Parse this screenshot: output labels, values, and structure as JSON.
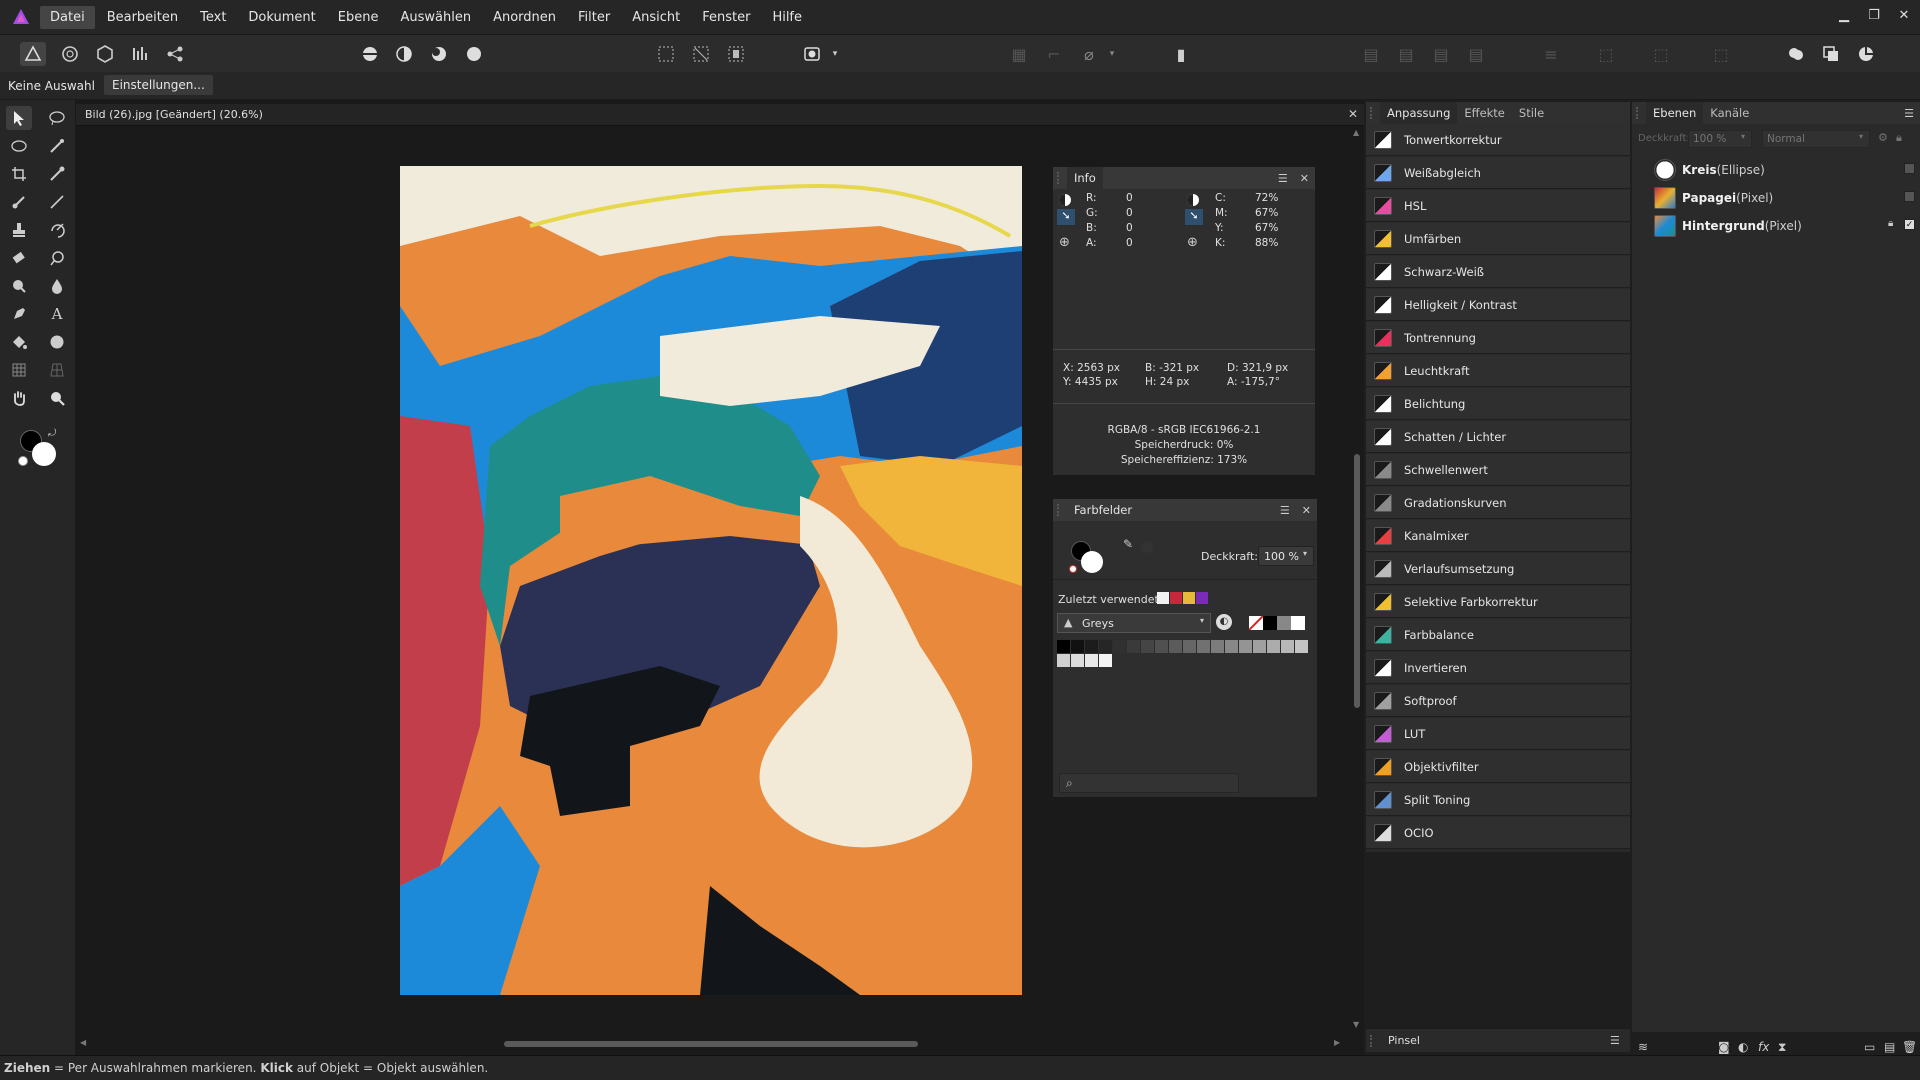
{
  "menu": {
    "items": [
      "Datei",
      "Bearbeiten",
      "Text",
      "Dokument",
      "Ebene",
      "Auswählen",
      "Anordnen",
      "Filter",
      "Ansicht",
      "Fenster",
      "Hilfe"
    ],
    "active_index": 0
  },
  "context": {
    "selection": "Keine Auswahl",
    "settings_button": "Einstellungen..."
  },
  "document": {
    "tab_title": "Bild (26).jpg [Geändert] (20.6%)",
    "close_symbol": "✕"
  },
  "info_panel": {
    "title": "Info",
    "rgb": [
      {
        "label": "R:",
        "value": "0"
      },
      {
        "label": "G:",
        "value": "0"
      },
      {
        "label": "B:",
        "value": "0"
      },
      {
        "label": "A:",
        "value": "0"
      }
    ],
    "cmyk": [
      {
        "label": "C:",
        "value": "72%"
      },
      {
        "label": "M:",
        "value": "67%"
      },
      {
        "label": "Y:",
        "value": "67%"
      },
      {
        "label": "K:",
        "value": "88%"
      }
    ],
    "coords": [
      {
        "label": "X:",
        "value": "2563 px"
      },
      {
        "label": "B:",
        "value": "-321 px"
      },
      {
        "label": "D:",
        "value": "321,9 px"
      },
      {
        "label": "Y:",
        "value": "4435 px"
      },
      {
        "label": "H:",
        "value": "24 px"
      },
      {
        "label": "A:",
        "value": "-175,7°"
      }
    ],
    "color_profile": "RGBA/8 - sRGB IEC61966-2.1",
    "memory_pressure": "Speicherdruck: 0%",
    "memory_efficiency": "Speichereffizienz: 173%"
  },
  "swatches_panel": {
    "title": "Farbfelder",
    "opacity_label": "Deckkraft:",
    "opacity_value": "100 %",
    "recent_label": "Zuletzt verwendet:",
    "recent_colors": [
      "#f2f2f2",
      "#c8283c",
      "#e8b83a",
      "#7a2bb8"
    ],
    "palette_name": "Greys",
    "greys": [
      "#000000",
      "#111111",
      "#1c1c1c",
      "#262626",
      "#303030",
      "#3a3a3a",
      "#454545",
      "#505050",
      "#5b5b5b",
      "#666666",
      "#717171",
      "#7c7c7c",
      "#888888",
      "#949494",
      "#a0a0a0",
      "#acacac",
      "#b8b8b8",
      "#c4c4c4",
      "#d0d0d0",
      "#dcdcdc",
      "#e8e8e8",
      "#f4f4f4"
    ],
    "search_placeholder": ""
  },
  "adjust_panel": {
    "tabs": [
      "Anpassung",
      "Effekte",
      "Stile"
    ],
    "active_tab": 0,
    "items": [
      {
        "label": "Tonwertkorrektur",
        "color": "#ffffff"
      },
      {
        "label": "Weißabgleich",
        "color": "#6fa8e8"
      },
      {
        "label": "HSL",
        "color": "#e84ca0"
      },
      {
        "label": "Umfärben",
        "color": "#f0c030"
      },
      {
        "label": "Schwarz-Weiß",
        "color": "#ffffff"
      },
      {
        "label": "Helligkeit / Kontrast",
        "color": "#ffffff"
      },
      {
        "label": "Tontrennung",
        "color": "#e8305a"
      },
      {
        "label": "Leuchtkraft",
        "color": "#f2a030"
      },
      {
        "label": "Belichtung",
        "color": "#ffffff"
      },
      {
        "label": "Schatten / Lichter",
        "color": "#ffffff"
      },
      {
        "label": "Schwellenwert",
        "color": "#8a8a8a"
      },
      {
        "label": "Gradationskurven",
        "color": "#8a8a8a"
      },
      {
        "label": "Kanalmixer",
        "color": "#e84040"
      },
      {
        "label": "Verlaufsumsetzung",
        "color": "#bbbbbb"
      },
      {
        "label": "Selektive Farbkorrektur",
        "color": "#f0c030"
      },
      {
        "label": "Farbbalance",
        "color": "#40b0a0"
      },
      {
        "label": "Invertieren",
        "color": "#ffffff"
      },
      {
        "label": "Softproof",
        "color": "#a0a0a0"
      },
      {
        "label": "LUT",
        "color": "#c060d0"
      },
      {
        "label": "Objektivfilter",
        "color": "#f0a020"
      },
      {
        "label": "Split Toning",
        "color": "#6090d0"
      },
      {
        "label": "OCIO",
        "color": "#dddddd"
      }
    ],
    "footer_label": "Pinsel"
  },
  "layers_panel": {
    "tabs": [
      "Ebenen",
      "Kanäle"
    ],
    "active_tab": 0,
    "opacity_label": "Deckkraft:",
    "opacity_value": "100 %",
    "blend_mode": "Normal",
    "layers": [
      {
        "name": "Kreis",
        "type": "(Ellipse)"
      },
      {
        "name": "Papagei",
        "type": "(Pixel)"
      },
      {
        "name": "Hintergrund",
        "type": "(Pixel)"
      }
    ]
  },
  "status": {
    "bold1": "Ziehen",
    "text1": " = Per Auswahlrahmen markieren. ",
    "bold2": "Klick",
    "text2": " auf Objekt = Objekt auswählen."
  }
}
